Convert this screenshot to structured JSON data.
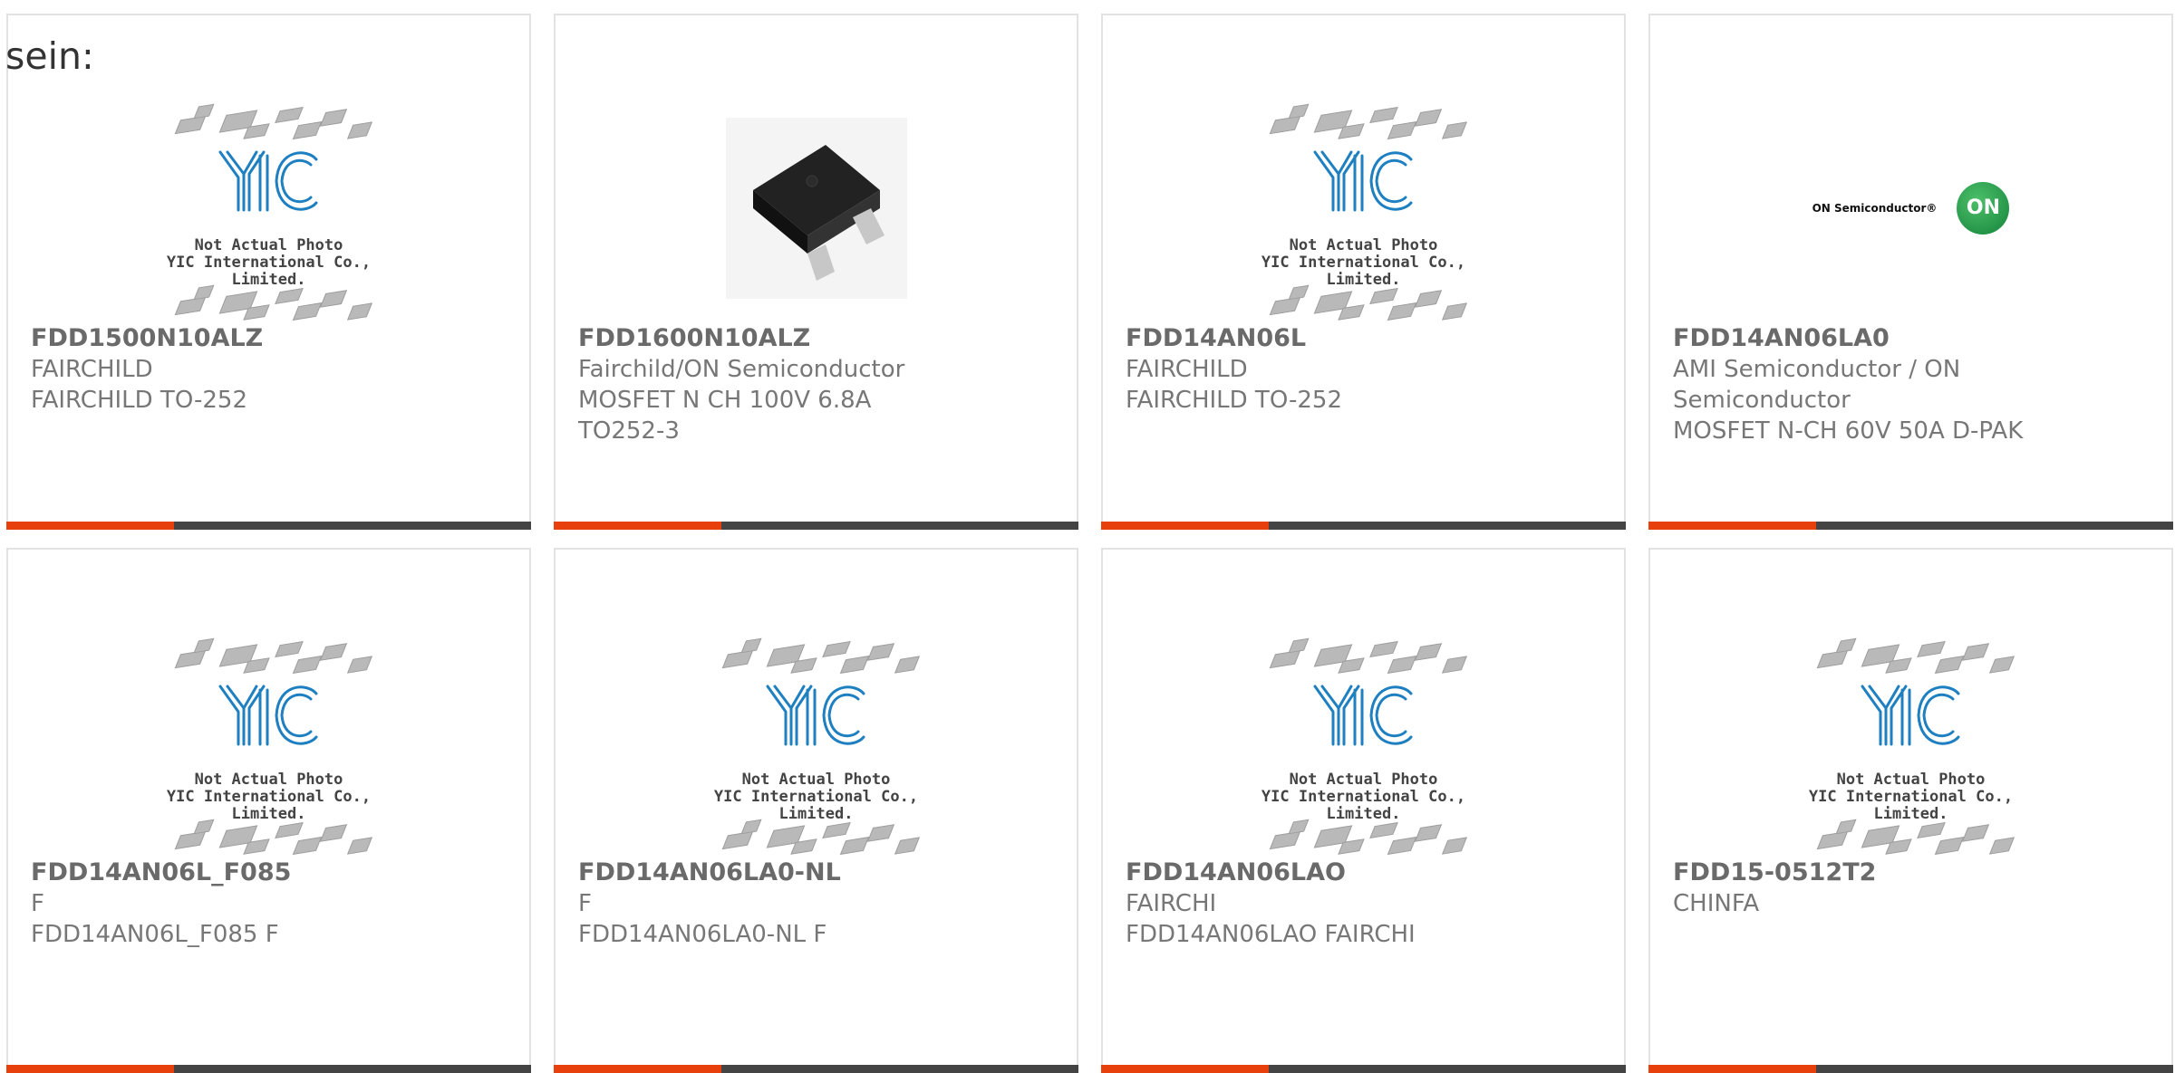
{
  "heading": "sein:",
  "placeholder": {
    "line1": "Not Actual Photo",
    "line2": "YIC International Co., Limited."
  },
  "onsemi_logo": {
    "wordmark": "ON Semiconductor®",
    "badge": "ON"
  },
  "colors": {
    "accent": "#e8400c",
    "bar": "#444444",
    "text": "#777777",
    "border": "#e2e2e2",
    "yic_blue": "#1e7fc1"
  },
  "products": [
    {
      "part": "FDD1500N10ALZ",
      "manufacturer": "FAIRCHILD",
      "description": "FAIRCHILD TO-252",
      "image": "yic-placeholder"
    },
    {
      "part": "FDD1600N10ALZ",
      "manufacturer": "Fairchild/ON Semiconductor",
      "description": "MOSFET N CH 100V 6.8A TO252-3",
      "image": "mosfet-photo"
    },
    {
      "part": "FDD14AN06L",
      "manufacturer": "FAIRCHILD",
      "description": "FAIRCHILD TO-252",
      "image": "yic-placeholder"
    },
    {
      "part": "FDD14AN06LA0",
      "manufacturer": "AMI Semiconductor / ON Semiconductor",
      "description": "MOSFET N-CH 60V 50A D-PAK",
      "image": "onsemi-logo"
    },
    {
      "part": "FDD14AN06L_F085",
      "manufacturer": "F",
      "description": "FDD14AN06L_F085 F",
      "image": "yic-placeholder"
    },
    {
      "part": "FDD14AN06LA0-NL",
      "manufacturer": "F",
      "description": "FDD14AN06LA0-NL F",
      "image": "yic-placeholder"
    },
    {
      "part": "FDD14AN06LAO",
      "manufacturer": "FAIRCHI",
      "description": "FDD14AN06LAO FAIRCHI",
      "image": "yic-placeholder"
    },
    {
      "part": "FDD15-0512T2",
      "manufacturer": "CHINFA",
      "description": "",
      "image": "yic-placeholder"
    }
  ]
}
